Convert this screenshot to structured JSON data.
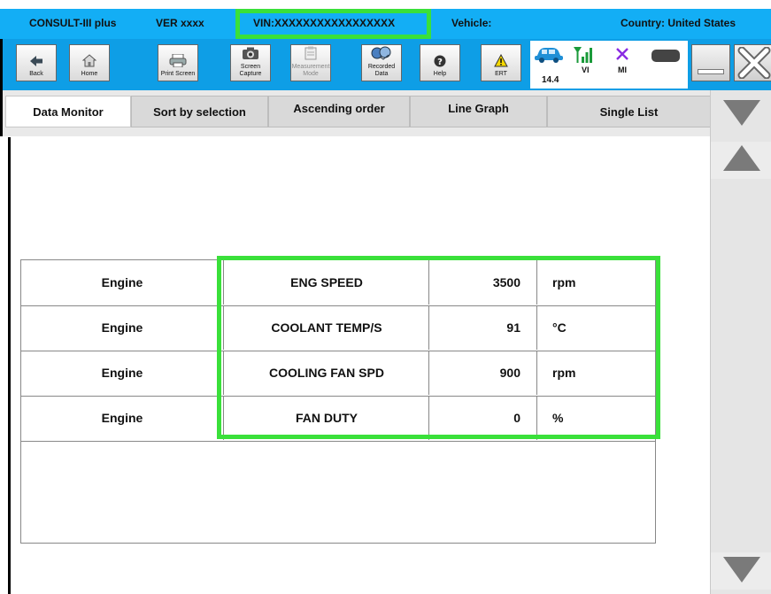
{
  "header": {
    "app_name": "CONSULT-III plus",
    "version": "VER xxxx",
    "vin": "VIN:XXXXXXXXXXXXXXXXX",
    "vehicle_label": "Vehicle:",
    "country": "Country: United States"
  },
  "toolbar": {
    "buttons": [
      {
        "label": "Back",
        "icon": "back-arrow-icon"
      },
      {
        "label": "Home",
        "icon": "home-icon"
      },
      {
        "label": "Print Screen",
        "icon": "printer-icon"
      },
      {
        "label": "Screen\nCapture",
        "icon": "camera-icon"
      },
      {
        "label": "Measurement\nMode",
        "icon": "clipboard-icon"
      },
      {
        "label": "Recorded\nData",
        "icon": "recorded-data-icon"
      },
      {
        "label": "Help",
        "icon": "help-icon"
      },
      {
        "label": "ERT",
        "icon": "warning-icon"
      }
    ],
    "status": {
      "voltage": "14.4",
      "vi_label": "VI",
      "mi_label": "MI"
    }
  },
  "tabs": [
    "Data Monitor",
    "Sort by selection",
    "Ascending order",
    "Line Graph",
    "Single List"
  ],
  "table": {
    "rows": [
      {
        "system": "Engine",
        "item": "ENG SPEED",
        "value": "3500",
        "unit": "rpm"
      },
      {
        "system": "Engine",
        "item": "COOLANT TEMP/S",
        "value": "91",
        "unit": "°C"
      },
      {
        "system": "Engine",
        "item": "COOLING FAN SPD",
        "value": "900",
        "unit": "rpm"
      },
      {
        "system": "Engine",
        "item": "FAN DUTY",
        "value": "0",
        "unit": "%"
      }
    ]
  },
  "colors": {
    "header_blue": "#13aef5",
    "toolbar_blue": "#0e9ee6",
    "highlight_green": "#3ae03a",
    "signal_green": "#1a9a3a",
    "mi_purple": "#8a2be2"
  }
}
